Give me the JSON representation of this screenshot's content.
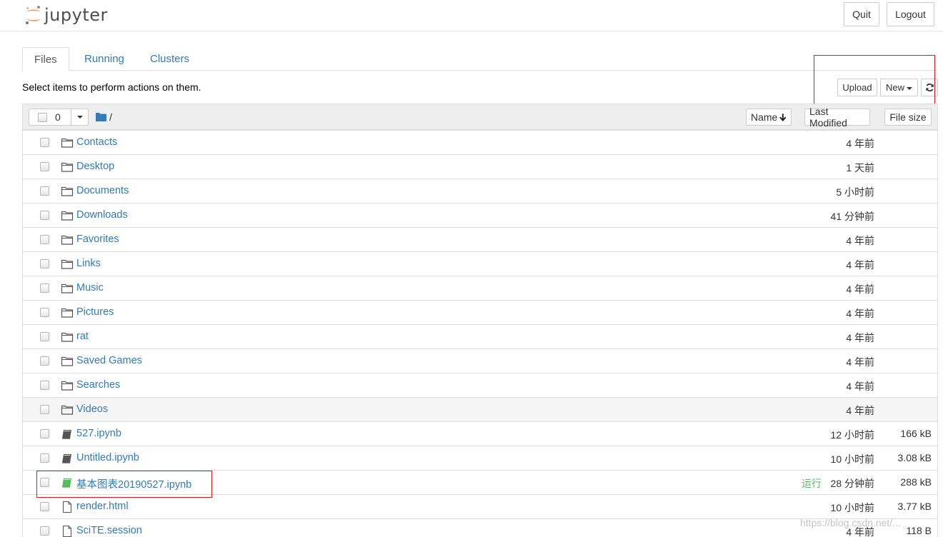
{
  "app": {
    "logo_text": "jupyter"
  },
  "header": {
    "quit_label": "Quit",
    "logout_label": "Logout"
  },
  "tabs": [
    {
      "label": "Files",
      "active": true
    },
    {
      "label": "Running",
      "active": false
    },
    {
      "label": "Clusters",
      "active": false
    }
  ],
  "toolbar": {
    "instructions": "Select items to perform actions on them.",
    "upload_label": "Upload",
    "new_label": "New"
  },
  "list_header": {
    "selected_count": "0",
    "breadcrumb": "/",
    "sort_name_label": "Name",
    "sort_modified_label": "Last Modified",
    "sort_size_label": "File size"
  },
  "files": [
    {
      "name": "Contacts",
      "type": "folder",
      "modified": "4 年前",
      "size": ""
    },
    {
      "name": "Desktop",
      "type": "folder",
      "modified": "1 天前",
      "size": ""
    },
    {
      "name": "Documents",
      "type": "folder",
      "modified": "5 小时前",
      "size": ""
    },
    {
      "name": "Downloads",
      "type": "folder",
      "modified": "41 分钟前",
      "size": ""
    },
    {
      "name": "Favorites",
      "type": "folder",
      "modified": "4 年前",
      "size": ""
    },
    {
      "name": "Links",
      "type": "folder",
      "modified": "4 年前",
      "size": ""
    },
    {
      "name": "Music",
      "type": "folder",
      "modified": "4 年前",
      "size": ""
    },
    {
      "name": "Pictures",
      "type": "folder",
      "modified": "4 年前",
      "size": ""
    },
    {
      "name": "rat",
      "type": "folder",
      "modified": "4 年前",
      "size": ""
    },
    {
      "name": "Saved Games",
      "type": "folder",
      "modified": "4 年前",
      "size": ""
    },
    {
      "name": "Searches",
      "type": "folder",
      "modified": "4 年前",
      "size": ""
    },
    {
      "name": "Videos",
      "type": "folder",
      "modified": "4 年前",
      "size": ""
    },
    {
      "name": "527.ipynb",
      "type": "notebook",
      "modified": "12 小时前",
      "size": "166 kB"
    },
    {
      "name": "Untitled.ipynb",
      "type": "notebook",
      "modified": "10 小时前",
      "size": "3.08 kB"
    },
    {
      "name": "基本图表20190527.ipynb",
      "type": "notebook-running",
      "running_label": "运行",
      "modified": "28 分钟前",
      "size": "288 kB"
    },
    {
      "name": "render.html",
      "type": "file",
      "modified": "10 小时前",
      "size": "3.77 kB"
    },
    {
      "name": "SciTE.session",
      "type": "file",
      "modified": "4 年前",
      "size": "118 B"
    }
  ],
  "watermark": "https://blog.csdn.net/...",
  "colors": {
    "link": "#337ab7",
    "running": "#5cb85c",
    "highlight_box": "#e0191f",
    "logo_orange": "#f37726"
  }
}
